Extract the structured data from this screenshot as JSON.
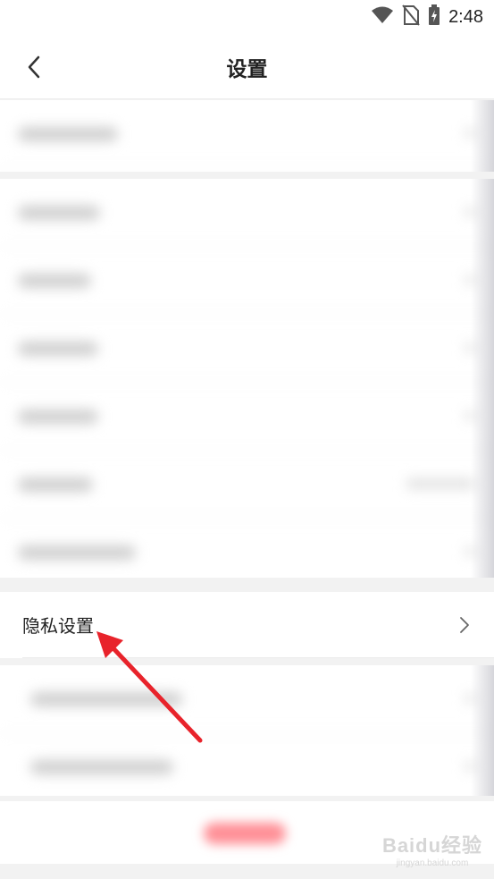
{
  "status_bar": {
    "time": "2:48",
    "icons": [
      "wifi-icon",
      "no-sim-icon",
      "battery-charging-icon"
    ]
  },
  "header": {
    "title": "设置",
    "back_icon": "chevron-left-icon"
  },
  "privacy_row": {
    "label": "隐私设置",
    "chevron_icon": "chevron-right-icon"
  },
  "watermark": {
    "main": "Baidu经验",
    "sub": "jingyan.baidu.com"
  },
  "colors": {
    "accent": "#e8232b",
    "logout_button": "#ff8f96",
    "background": "#f2f2f2"
  }
}
